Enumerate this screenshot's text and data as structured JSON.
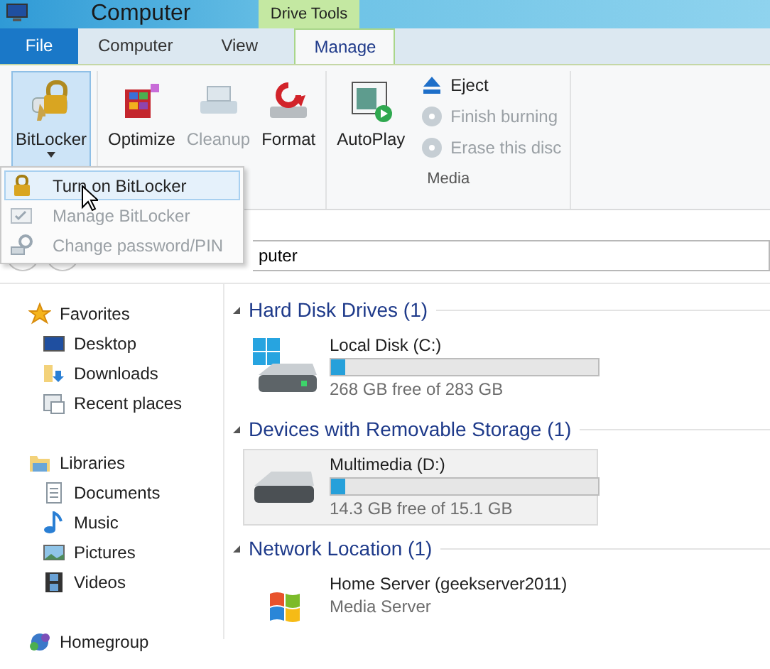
{
  "window": {
    "title": "Computer"
  },
  "context_tab": {
    "label": "Drive Tools"
  },
  "tabs": [
    {
      "label": "File",
      "kind": "file",
      "selected": false
    },
    {
      "label": "Computer",
      "kind": "tab",
      "selected": false
    },
    {
      "label": "View",
      "kind": "tab",
      "selected": false
    },
    {
      "label": "Manage",
      "kind": "tab",
      "selected": true
    }
  ],
  "ribbon": {
    "groups": [
      {
        "buttons": [
          {
            "label": "BitLocker",
            "kind": "large",
            "disabled": false,
            "pressed": true,
            "dropdown": true
          }
        ]
      },
      {
        "buttons": [
          {
            "label": "Optimize",
            "kind": "large",
            "disabled": false
          },
          {
            "label": "Cleanup",
            "kind": "large",
            "disabled": true
          },
          {
            "label": "Format",
            "kind": "large",
            "disabled": false
          }
        ]
      },
      {
        "label": "Media",
        "buttons": [
          {
            "label": "AutoPlay",
            "kind": "large",
            "disabled": false
          },
          {
            "label": "Eject",
            "kind": "small",
            "disabled": false
          },
          {
            "label": "Finish burning",
            "kind": "small",
            "disabled": true
          },
          {
            "label": "Erase this disc",
            "kind": "small",
            "disabled": true
          }
        ]
      }
    ]
  },
  "menu": {
    "items": [
      {
        "label": "Turn on BitLocker",
        "disabled": false,
        "selected": true
      },
      {
        "label": "Manage BitLocker",
        "disabled": true,
        "selected": false
      },
      {
        "label": "Change password/PIN",
        "disabled": true,
        "selected": false
      }
    ]
  },
  "address_bar": {
    "value": "puter"
  },
  "sidebar": {
    "items": [
      {
        "label": "Favorites",
        "children": [
          {
            "label": "Desktop"
          },
          {
            "label": "Downloads"
          },
          {
            "label": "Recent places"
          }
        ]
      },
      {
        "label": "Libraries",
        "children": [
          {
            "label": "Documents"
          },
          {
            "label": "Music"
          },
          {
            "label": "Pictures"
          },
          {
            "label": "Videos"
          }
        ]
      },
      {
        "label": "Homegroup"
      }
    ]
  },
  "groups": [
    {
      "title": "Hard Disk Drives (1)",
      "expanded": true,
      "items": [
        {
          "kind": "drive",
          "name": "Local Disk (C:)",
          "level": 0.053,
          "detail": "268 GB free of 283 GB",
          "selected": false
        }
      ]
    },
    {
      "title": "Devices with Removable Storage (1)",
      "expanded": true,
      "items": [
        {
          "kind": "removable",
          "name": "Multimedia (D:)",
          "level": 0.053,
          "detail": "14.3 GB free of 15.1 GB",
          "selected": true
        }
      ]
    },
    {
      "title": "Network Location (1)",
      "expanded": true,
      "items": [
        {
          "kind": "network",
          "name": "Home Server (geekserver2011)",
          "detail": "Media Server",
          "selected": false
        }
      ]
    }
  ]
}
